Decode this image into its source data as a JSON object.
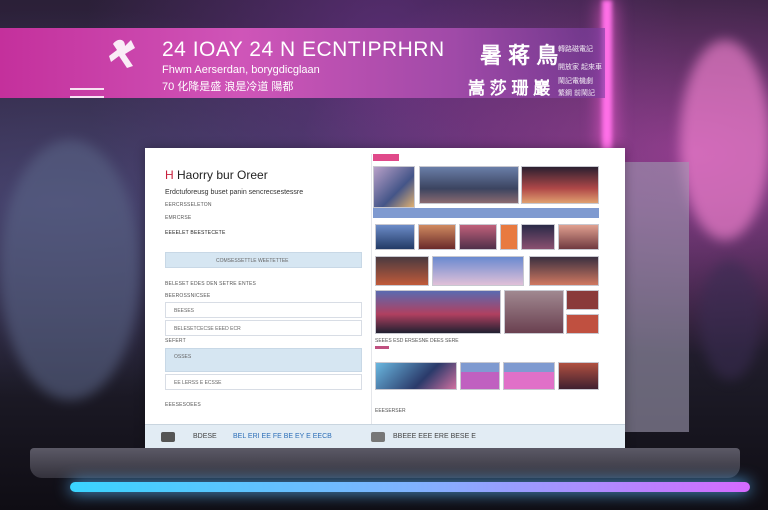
{
  "banner": {
    "title": "24 IOAY 24 N ECNTIPRHRN",
    "subtitle_line1": "Fhwm Aerserdan, borygdicglaan",
    "subtitle_line2": "70 化降是盛 浪是冷道 陽都",
    "cjk_heading": "暑 蒋 鳥",
    "cjk_subheading": "嵩 莎 珊 巖",
    "side_labels": [
      "轉路磁電記",
      "開放家 起來車",
      "鬧記電機劇",
      "繁鋼 前鬧記"
    ]
  },
  "form": {
    "title_accent": "H",
    "title_rest": "Haorry bur Oreer",
    "description": "Erdctuforeusg buset panin sencrecsestessre",
    "label_1": "EERCRSSELETON",
    "label_1b": "EMRCRSE",
    "label_2": "EEEELET  BEESTECETE",
    "button_1": "COMSESSETTLE WEETETTEE",
    "label_3": "BELESET EDES DEN SETRE ENTES",
    "label_4": "BEEROSSNICSEE",
    "label_5": "BEESES",
    "label_6": "BELESETCECSE  EEED  ECR",
    "label_7": "SEFERT",
    "label_8": "OSSES",
    "button_2": "EE   LERSS   E   ECSSE",
    "label_9": "EEESESOEES"
  },
  "gallery": {
    "tag": "",
    "caption_1": "SEEES ESD ERSESNE DEES SERE",
    "caption_2": "EEESERSER"
  },
  "footer": {
    "item_1": "BDESE",
    "item_2": "BEL ERI EE FE BE EY E EECB",
    "item_3": "BBEEE EEE ERE BESE E"
  },
  "colors": {
    "banner": "#c4309c",
    "accent_red": "#c81e3c",
    "band_blue": "#7f9ad0",
    "footer_bg": "#e2ecf4"
  }
}
